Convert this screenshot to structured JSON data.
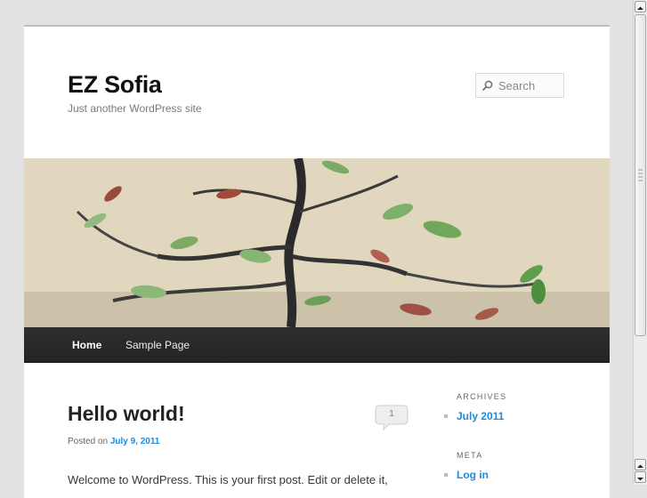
{
  "site": {
    "title": "EZ Sofia",
    "description": "Just another WordPress site"
  },
  "search": {
    "placeholder": "Search"
  },
  "nav": {
    "items": [
      {
        "label": "Home",
        "active": true
      },
      {
        "label": "Sample Page",
        "active": false
      }
    ]
  },
  "post": {
    "title": "Hello world!",
    "comments_count": "1",
    "posted_prefix": "Posted on",
    "date": "July 9, 2011",
    "excerpt": "Welcome to WordPress. This is your first post. Edit or delete it,"
  },
  "sidebar": {
    "archives": {
      "title": "ARCHIVES",
      "items": [
        "July 2011"
      ]
    },
    "meta": {
      "title": "META",
      "items": [
        "Log in"
      ]
    }
  },
  "colors": {
    "link": "#1b8be0",
    "nav_bg": "#262626"
  }
}
